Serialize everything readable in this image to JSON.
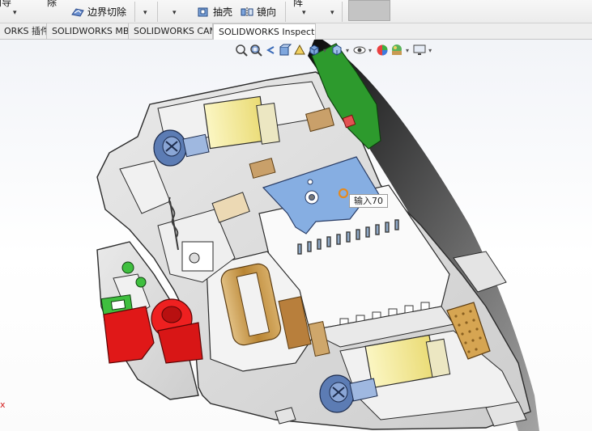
{
  "ribbon": {
    "partial_top_left": "向导",
    "partial_top_middle": "除",
    "boundary_cut_label": "边界切除",
    "shell_label": "抽壳",
    "mirror_label": "镜向",
    "partial_right_label": "阵",
    "dropdown_glyph": "▾"
  },
  "tabs": [
    {
      "label": "ORKS 插件",
      "active": false
    },
    {
      "label": "SOLIDWORKS MBD",
      "active": false
    },
    {
      "label": "SOLIDWORKS CAM",
      "active": false
    },
    {
      "label": "SOLIDWORKS Inspection",
      "active": true
    }
  ],
  "heads_up_toolbar": {
    "icons": [
      "zoom-to-fit-icon",
      "zoom-area-icon",
      "previous-view-icon",
      "section-view-icon",
      "dynamic-annotation-icon",
      "view-orientation-icon",
      "display-style-icon",
      "hide-show-icon",
      "edit-appearance-icon",
      "apply-scene-icon",
      "view-settings-icon"
    ],
    "dropdown_glyph": "▾"
  },
  "viewport": {
    "tooltip_text": "输入70",
    "corner_mark": "x"
  },
  "colors": {
    "housing": "#dedede",
    "housing_edge": "#2a2a2a",
    "coil_yellow": "#f4ec9e",
    "cam_blue": "#86aee2",
    "knob_red": "#e01818",
    "green_part": "#2d9a2d",
    "copper": "#c89a52",
    "screw_blue": "#5c7cb4"
  }
}
